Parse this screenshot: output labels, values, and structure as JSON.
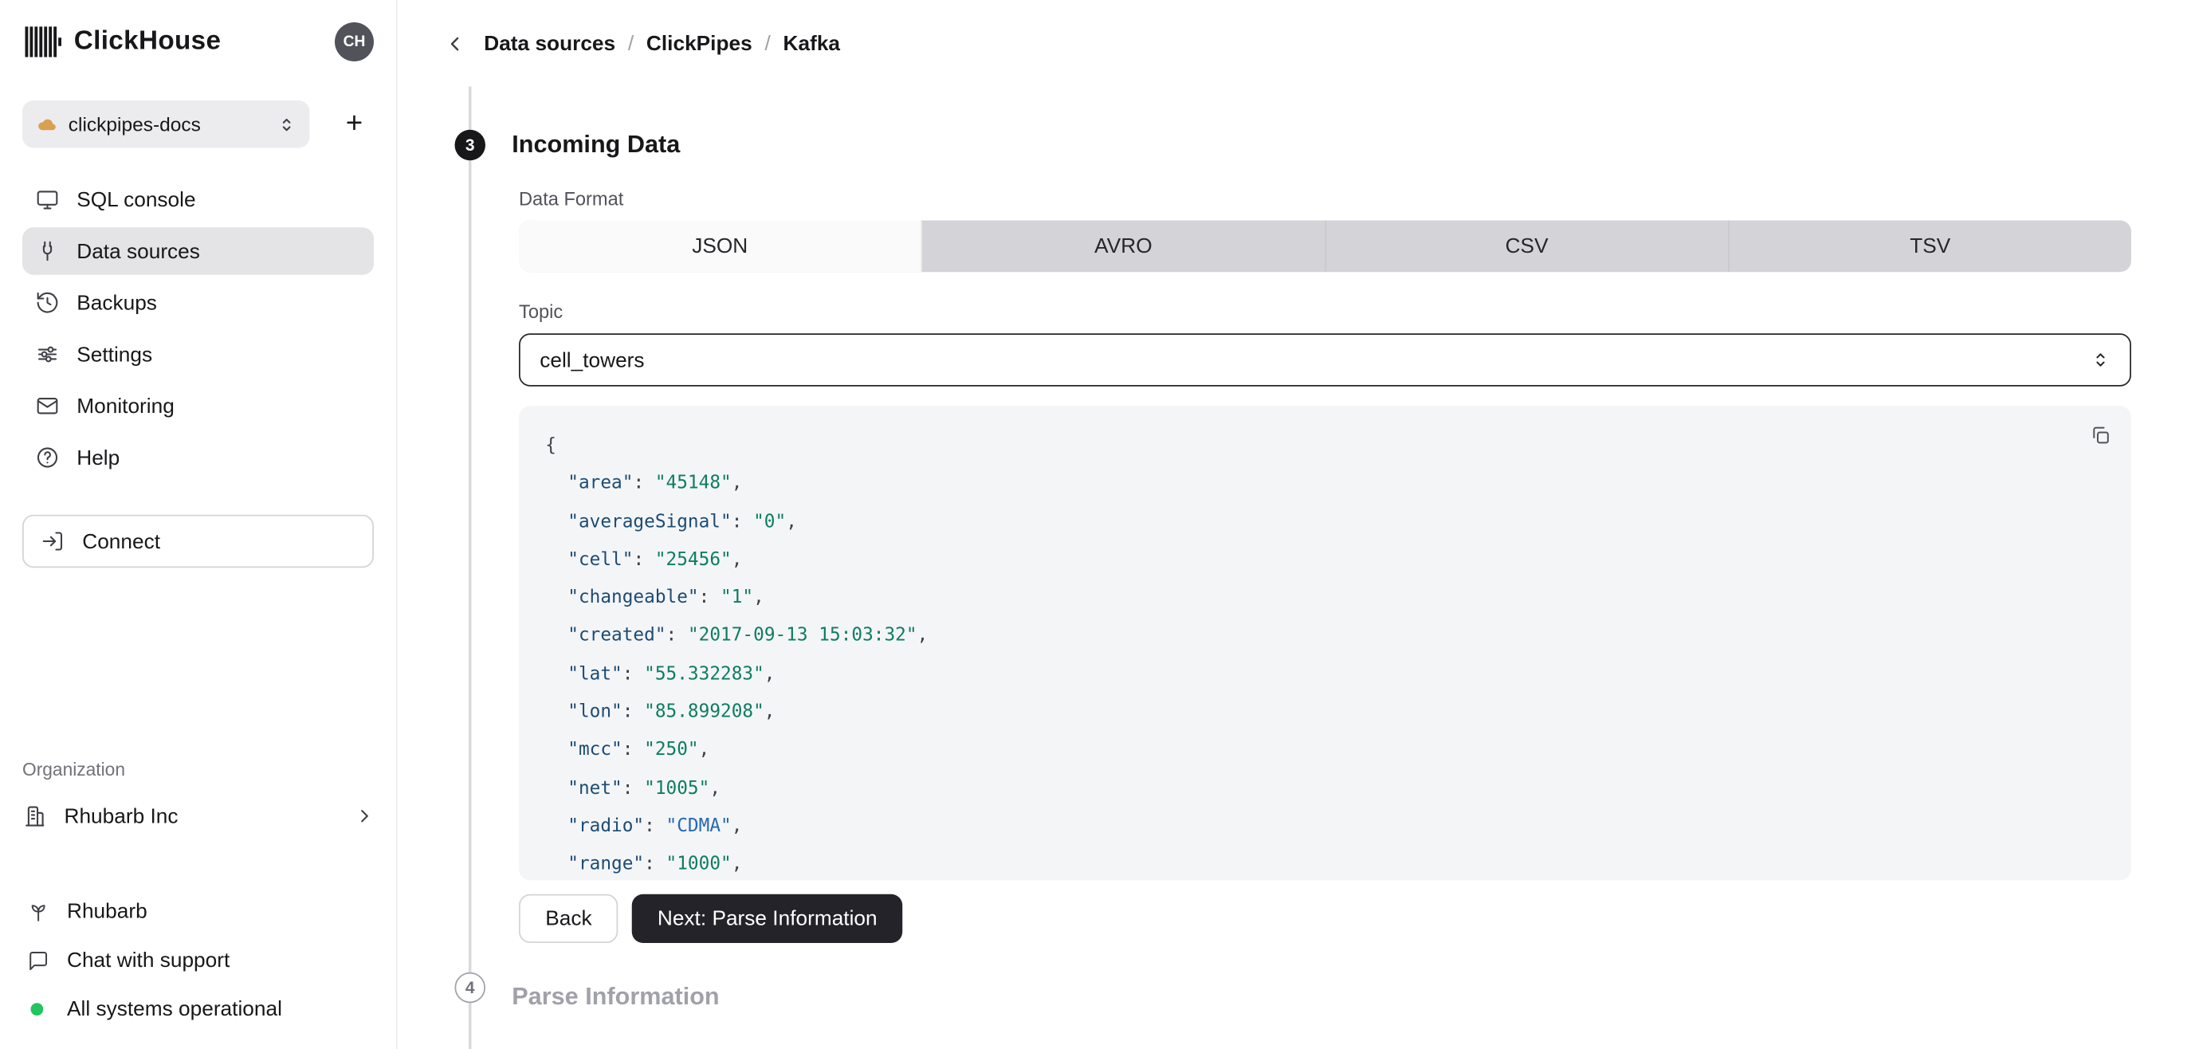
{
  "colors": {
    "status_green": "#22c55e",
    "dark_button": "#232329",
    "code_key": "#1c4c74",
    "code_value_number": "#0d7d62",
    "code_value_string": "#2469b3"
  },
  "sidebar": {
    "brand": "ClickHouse",
    "avatar": "CH",
    "service_selector": {
      "label": "clickpipes-docs"
    },
    "add_label": "+",
    "nav": [
      {
        "label": "SQL console"
      },
      {
        "label": "Data sources"
      },
      {
        "label": "Backups"
      },
      {
        "label": "Settings"
      },
      {
        "label": "Monitoring"
      },
      {
        "label": "Help"
      }
    ],
    "connect_label": "Connect",
    "organization": {
      "section_label": "Organization",
      "name": "Rhubarb Inc"
    },
    "footer": [
      {
        "label": "Rhubarb"
      },
      {
        "label": "Chat with support"
      },
      {
        "label": "All systems operational"
      }
    ]
  },
  "breadcrumb": {
    "items": [
      "Data sources",
      "ClickPipes",
      "Kafka"
    ],
    "separator": "/"
  },
  "wizard": {
    "step3": {
      "number": "3",
      "title": "Incoming Data"
    },
    "step4": {
      "number": "4",
      "title": "Parse Information"
    },
    "data_format": {
      "label": "Data Format",
      "options": [
        "JSON",
        "AVRO",
        "CSV",
        "TSV"
      ],
      "selected": "JSON"
    },
    "topic": {
      "label": "Topic",
      "value": "cell_towers"
    },
    "preview": {
      "open_brace": "{",
      "colon": ": ",
      "comma": ",",
      "fields": [
        {
          "key": "area",
          "value": "45148",
          "value_type": "number"
        },
        {
          "key": "averageSignal",
          "value": "0",
          "value_type": "number"
        },
        {
          "key": "cell",
          "value": "25456",
          "value_type": "number"
        },
        {
          "key": "changeable",
          "value": "1",
          "value_type": "number"
        },
        {
          "key": "created",
          "value": "2017-09-13 15:03:32",
          "value_type": "number"
        },
        {
          "key": "lat",
          "value": "55.332283",
          "value_type": "number"
        },
        {
          "key": "lon",
          "value": "85.899208",
          "value_type": "number"
        },
        {
          "key": "mcc",
          "value": "250",
          "value_type": "number"
        },
        {
          "key": "net",
          "value": "1005",
          "value_type": "number"
        },
        {
          "key": "radio",
          "value": "CDMA",
          "value_type": "string"
        },
        {
          "key": "range",
          "value": "1000",
          "value_type": "number"
        }
      ]
    },
    "back_label": "Back",
    "next_label": "Next: Parse Information"
  }
}
